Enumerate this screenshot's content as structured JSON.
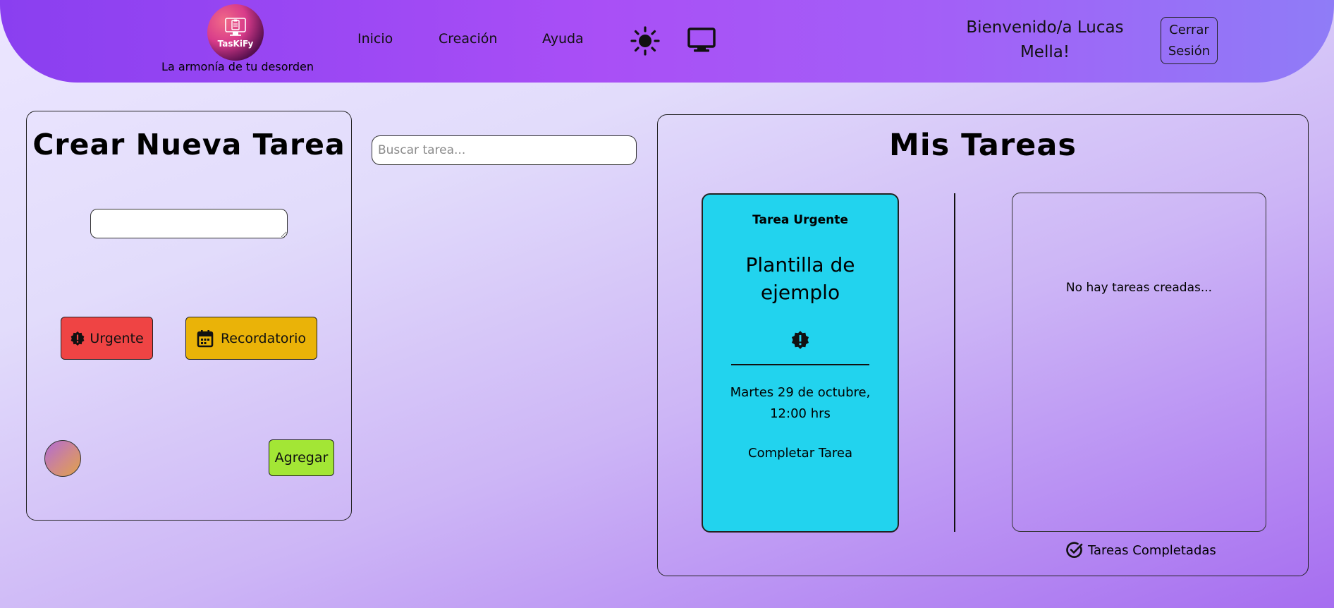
{
  "header": {
    "logo_text": "TasKiFy",
    "tagline": "La armonía de tu desorden",
    "nav": [
      {
        "label": "Inicio"
      },
      {
        "label": "Creación"
      },
      {
        "label": "Ayuda"
      }
    ],
    "theme_icons": [
      "sun-icon",
      "monitor-icon"
    ],
    "welcome_line1": "Bienvenido/a Lucas",
    "welcome_line2": "Mella!",
    "logout_line1": "Cerrar",
    "logout_line2": "Sesión"
  },
  "create": {
    "title": "Crear Nueva Tarea",
    "textarea_value": "",
    "urgent_label": "Urgente",
    "reminder_label": "Recordatorio",
    "add_label": "Agregar"
  },
  "search": {
    "placeholder": "Buscar tarea..."
  },
  "tasks": {
    "title": "Mis Tareas",
    "card": {
      "type": "Tarea Urgente",
      "name": "Plantilla de ejemplo",
      "date_line1": "Martes 29 de octubre,",
      "date_line2": "12:00 hrs",
      "complete_label": "Completar Tarea",
      "color": "#22d3ee"
    },
    "empty_message": "No hay tareas creadas...",
    "completed_label": "Tareas Completadas"
  },
  "colors": {
    "urgent": "#ef4444",
    "reminder": "#eab308",
    "add": "#a3e635",
    "header_start": "#8a3ff0",
    "header_end": "#8f7cf7"
  }
}
